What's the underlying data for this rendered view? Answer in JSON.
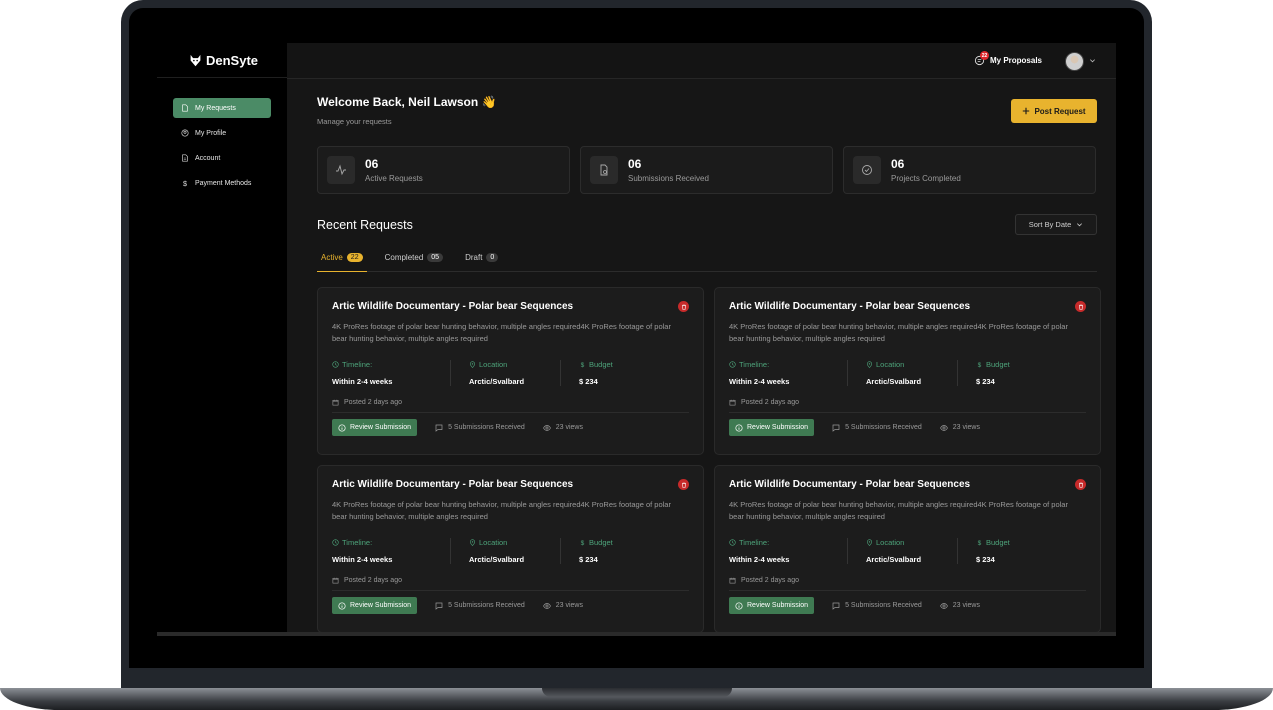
{
  "app": {
    "name": "DenSyte"
  },
  "sidebar": {
    "items": [
      {
        "label": "My Requests",
        "icon": "document-icon",
        "active": true
      },
      {
        "label": "My Profile",
        "icon": "user-circle-icon",
        "active": false
      },
      {
        "label": "Account",
        "icon": "file-icon",
        "active": false
      },
      {
        "label": "Payment Methods",
        "icon": "dollar-icon",
        "active": false
      }
    ]
  },
  "topbar": {
    "proposals_label": "My Proposals",
    "proposals_badge": "22"
  },
  "header": {
    "welcome": "Welcome Back, Neil Lawson 👋",
    "subtitle": "Manage your requests",
    "post_button": "Post Request"
  },
  "stats": [
    {
      "value": "06",
      "label": "Active Requests",
      "icon": "activity-icon"
    },
    {
      "value": "06",
      "label": "Submissions Received",
      "icon": "file-check-icon"
    },
    {
      "value": "06",
      "label": "Projects Completed",
      "icon": "check-circle-icon"
    }
  ],
  "recent": {
    "title": "Recent Requests",
    "sort_label": "Sort By Date",
    "tabs": [
      {
        "label": "Active",
        "count": "22",
        "active": true
      },
      {
        "label": "Completed",
        "count": "05",
        "active": false
      },
      {
        "label": "Draft",
        "count": "0",
        "active": false
      }
    ],
    "cards": [
      {
        "title": "Artic Wildlife Documentary - Polar bear Sequences",
        "description": "4K ProRes footage of polar bear hunting behavior, multiple angles required4K ProRes footage of polar bear hunting behavior, multiple angles required",
        "timeline_label": "Timeline:",
        "timeline_value": "Within 2-4 weeks",
        "location_label": "Location",
        "location_value": "Arctic/Svalbard",
        "budget_label": "Budget",
        "budget_value": "$ 234",
        "posted": "Posted 2 days ago",
        "review_label": "Review Submission",
        "submissions": "5 Submissions Received",
        "views": "23 views"
      },
      {
        "title": "Artic Wildlife Documentary - Polar bear Sequences",
        "description": "4K ProRes footage of polar bear hunting behavior, multiple angles required4K ProRes footage of polar bear hunting behavior, multiple angles required",
        "timeline_label": "Timeline:",
        "timeline_value": "Within 2-4 weeks",
        "location_label": "Location",
        "location_value": "Arctic/Svalbard",
        "budget_label": "Budget",
        "budget_value": "$ 234",
        "posted": "Posted 2 days ago",
        "review_label": "Review Submission",
        "submissions": "5 Submissions Received",
        "views": "23 views"
      },
      {
        "title": "Artic Wildlife Documentary - Polar bear Sequences",
        "description": "4K ProRes footage of polar bear hunting behavior, multiple angles required4K ProRes footage of polar bear hunting behavior, multiple angles required",
        "timeline_label": "Timeline:",
        "timeline_value": "Within 2-4 weeks",
        "location_label": "Location",
        "location_value": "Arctic/Svalbard",
        "budget_label": "Budget",
        "budget_value": "$ 234",
        "posted": "Posted 2 days ago",
        "review_label": "Review Submission",
        "submissions": "5 Submissions Received",
        "views": "23 views"
      },
      {
        "title": "Artic Wildlife Documentary - Polar bear Sequences",
        "description": "4K ProRes footage of polar bear hunting behavior, multiple angles required4K ProRes footage of polar bear hunting behavior, multiple angles required",
        "timeline_label": "Timeline:",
        "timeline_value": "Within 2-4 weeks",
        "location_label": "Location",
        "location_value": "Arctic/Svalbard",
        "budget_label": "Budget",
        "budget_value": "$ 234",
        "posted": "Posted 2 days ago",
        "review_label": "Review Submission",
        "submissions": "5 Submissions Received",
        "views": "23 views"
      }
    ]
  },
  "colors": {
    "accent": "#e8b32e",
    "primary_green": "#4b8b66",
    "danger": "#c72a2a"
  }
}
